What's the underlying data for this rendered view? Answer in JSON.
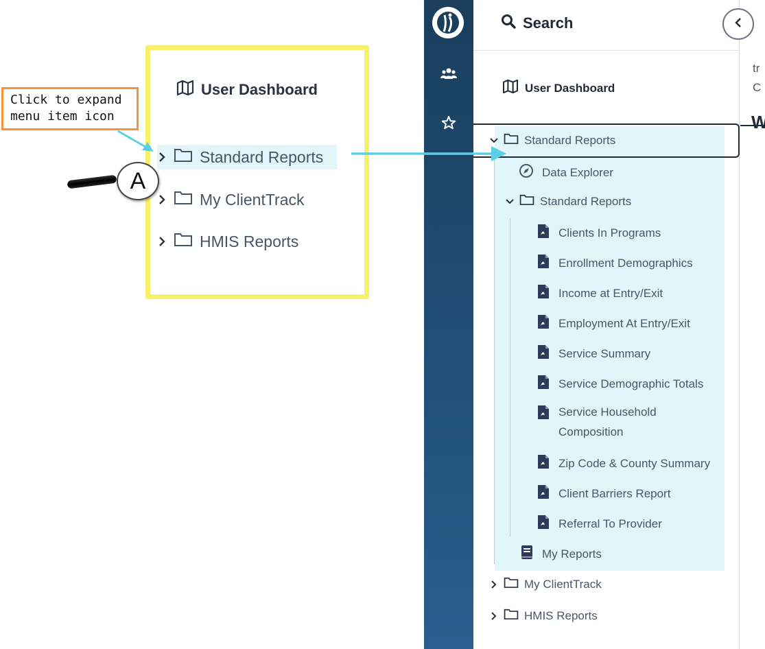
{
  "annotation": {
    "callout_lines": [
      "Click to expand",
      "menu item icon"
    ],
    "marker_label": "A",
    "accent_highlight": "#e2f5f9",
    "frame_color": "#f7f06b",
    "callout_color": "#f5933a",
    "arrow_color": "#5ccfe6"
  },
  "zoom": {
    "title": "User Dashboard",
    "items": [
      "Standard Reports",
      "My ClientTrack",
      "HMIS Reports"
    ]
  },
  "app": {
    "search_label": "Search",
    "dashboard_label": "User Dashboard",
    "tree": {
      "root": "Standard Reports",
      "data_explorer": "Data Explorer",
      "folder": "Standard Reports",
      "reports": [
        "Clients In Programs",
        "Enrollment Demographics",
        "Income at Entry/Exit",
        "Employment At Entry/Exit",
        "Service Summary",
        "Service Demographic Totals",
        "Service Household",
        "Composition",
        "Zip Code & County Summary",
        "Client Barriers Report",
        "Referral To Provider"
      ],
      "my_reports": "My Reports",
      "siblings": [
        "My ClientTrack",
        "HMIS Reports"
      ]
    },
    "content_fragments": [
      "tr",
      "C",
      "W"
    ]
  }
}
